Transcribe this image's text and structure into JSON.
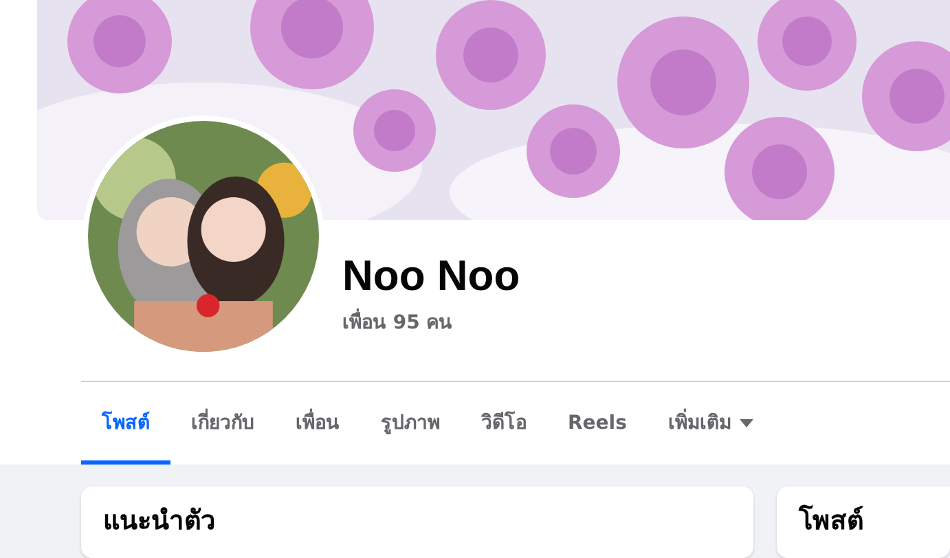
{
  "profile": {
    "name": "Noo Noo",
    "friends": "เพื่อน 95 คน"
  },
  "tabs": [
    {
      "label": "โพสต์",
      "selected": true
    },
    {
      "label": "เกี่ยวกับ",
      "selected": false
    },
    {
      "label": "เพื่อน",
      "selected": false
    },
    {
      "label": "รูปภาพ",
      "selected": false
    },
    {
      "label": "วิดีโอ",
      "selected": false
    },
    {
      "label": "Reels",
      "selected": false
    },
    {
      "label": "เพิ่มเติม",
      "selected": false,
      "dropdown": true
    }
  ],
  "cards": [
    {
      "title": "แนะนำตัว"
    },
    {
      "title": "โพสต์"
    }
  ]
}
